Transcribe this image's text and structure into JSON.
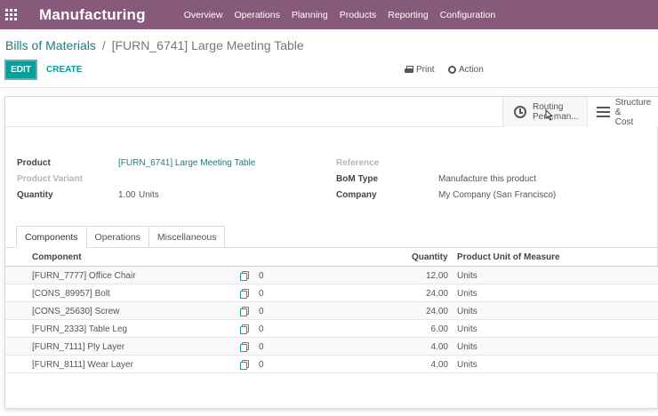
{
  "nav": {
    "app_title": "Manufacturing",
    "menu": [
      "Overview",
      "Operations",
      "Planning",
      "Products",
      "Reporting",
      "Configuration"
    ]
  },
  "breadcrumb": {
    "parent": "Bills of Materials",
    "separator": "/",
    "current": "[FURN_6741] Large Meeting Table"
  },
  "toolbar": {
    "edit_label": "EDIT",
    "create_label": "CREATE",
    "print_label": "Print",
    "action_label": "Action"
  },
  "smart_buttons": {
    "routing_line1": "Routing",
    "routing_line2": "Perf..man...",
    "structure_line1": "Structure &",
    "structure_line2": "Cost"
  },
  "form": {
    "product_label": "Product",
    "product_value": "[FURN_6741] Large Meeting Table",
    "variant_label": "Product Variant",
    "quantity_label": "Quantity",
    "quantity_value": "1.00",
    "quantity_uom": "Units",
    "reference_label": "Reference",
    "bom_type_label": "BoM Type",
    "bom_type_value": "Manufacture this product",
    "company_label": "Company",
    "company_value": "My Company (San Francisco)"
  },
  "tabs": [
    "Components",
    "Operations",
    "Miscellaneous"
  ],
  "table": {
    "headers": {
      "component": "Component",
      "quantity": "Quantity",
      "uom": "Product Unit of Measure"
    },
    "rows": [
      {
        "component": "[FURN_7777] Office Chair",
        "count": "0",
        "quantity": "12.00",
        "uom": "Units"
      },
      {
        "component": "[CONS_89957] Bolt",
        "count": "0",
        "quantity": "24.00",
        "uom": "Units"
      },
      {
        "component": "[CONS_25630] Screw",
        "count": "0",
        "quantity": "24.00",
        "uom": "Units"
      },
      {
        "component": "[FURN_2333] Table Leg",
        "count": "0",
        "quantity": "6.00",
        "uom": "Units"
      },
      {
        "component": "[FURN_7111] Ply Layer",
        "count": "0",
        "quantity": "4.00",
        "uom": "Units"
      },
      {
        "component": "[FURN_8111] Wear Layer",
        "count": "0",
        "quantity": "4.00",
        "uom": "Units"
      }
    ]
  },
  "colors": {
    "nav_bg": "#875a7b",
    "primary": "#00a09d",
    "link": "#1f7a7a"
  },
  "icons": [
    "apps-grid-icon",
    "printer-icon",
    "gear-icon",
    "clock-icon",
    "bars-icon",
    "copy-icon",
    "cursor-icon"
  ]
}
